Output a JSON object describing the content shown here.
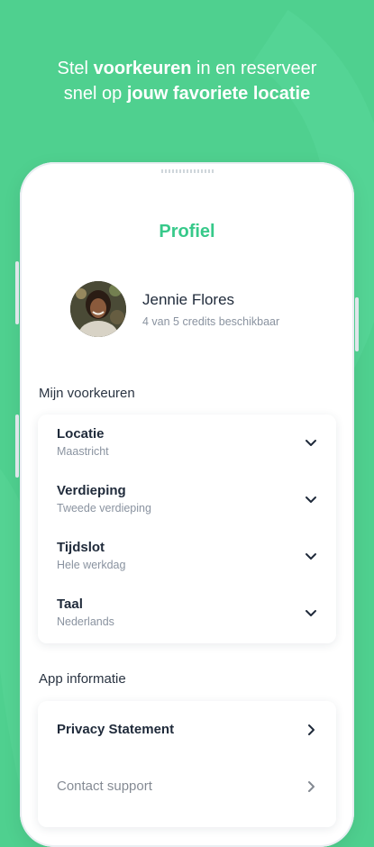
{
  "headline": {
    "line1_a": "Stel ",
    "line1_bold": "voorkeuren",
    "line1_b": " in en reserveer",
    "line2_a": "snel op ",
    "line2_bold": "jouw favoriete locatie"
  },
  "screen": {
    "title": "Profiel",
    "profile": {
      "name": "Jennie Flores",
      "credits": "4 van 5 credits beschikbaar"
    },
    "preferences": {
      "label": "Mijn voorkeuren",
      "items": [
        {
          "title": "Locatie",
          "value": "Maastricht"
        },
        {
          "title": "Verdieping",
          "value": "Tweede verdieping"
        },
        {
          "title": "Tijdslot",
          "value": "Hele werkdag"
        },
        {
          "title": "Taal",
          "value": "Nederlands"
        }
      ]
    },
    "app_info": {
      "label": "App informatie",
      "items": [
        {
          "title": "Privacy Statement"
        },
        {
          "title": "Contact support"
        }
      ]
    }
  },
  "icons": {
    "expand": "chevron-down-icon",
    "open": "chevron-right-icon"
  },
  "colors": {
    "background": "#4fd08f",
    "accent": "#37c98a",
    "text": "#1f2a3a",
    "muted": "#8a93a0"
  }
}
